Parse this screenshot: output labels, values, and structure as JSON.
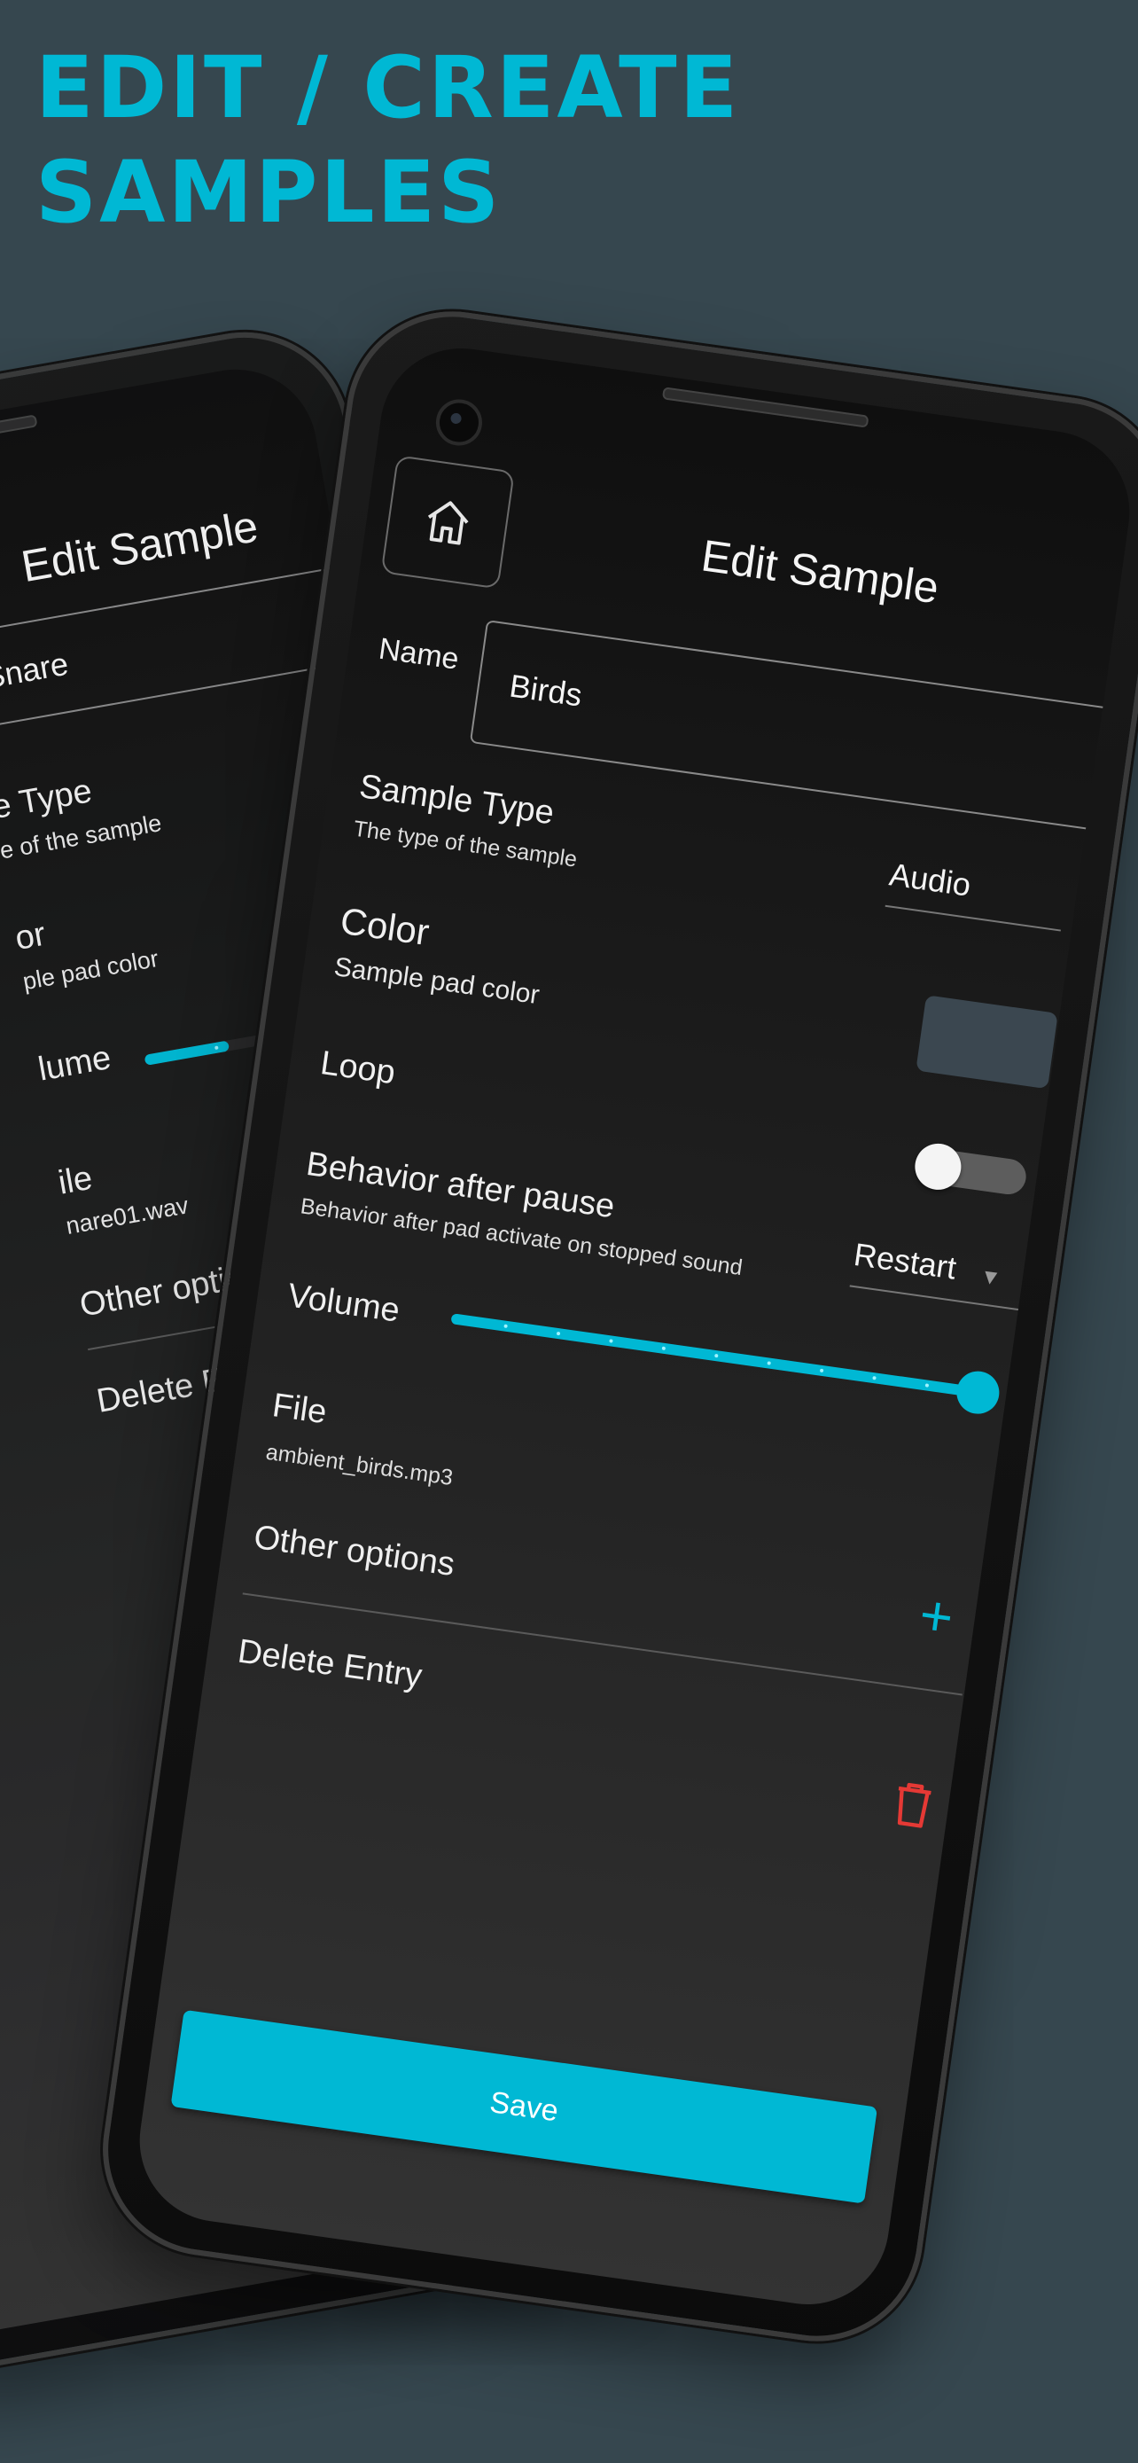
{
  "headline": {
    "line1": "EDIT / CREATE",
    "line2": "SAMPLES"
  },
  "front": {
    "title": "Edit Sample",
    "name_label": "Name",
    "name_value": "Birds",
    "sample_type": {
      "title": "Sample Type",
      "subtitle": "The type of the sample",
      "value": "Audio"
    },
    "color": {
      "title": "Color",
      "subtitle": "Sample pad color",
      "swatch": "#3b4750"
    },
    "loop": {
      "title": "Loop",
      "on": false
    },
    "behavior": {
      "title": "Behavior after pause",
      "subtitle": "Behavior after pad activate on stopped sound",
      "value": "Restart"
    },
    "volume": {
      "title": "Volume",
      "level": 1.0
    },
    "file": {
      "title": "File",
      "value": "ambient_birds.mp3"
    },
    "other_options": "Other options",
    "delete_entry": "Delete Entry",
    "save": "Save"
  },
  "back": {
    "title": "Edit Sample",
    "name_value": "Snare",
    "sample_type": {
      "title": "e Type",
      "subtitle": "e of the sample"
    },
    "color": {
      "title": "or",
      "subtitle": "ple pad color"
    },
    "volume_title": "lume",
    "volume_level": 0.3,
    "file": {
      "title": "ile",
      "value": "nare01.wav"
    },
    "other_options": "Other options",
    "delete_entry": "Delete Entry"
  },
  "colors": {
    "accent": "#00b8d4",
    "background": "#36474f",
    "danger": "#e53935"
  },
  "icons": {
    "home": "home-icon",
    "plus": "plus-icon",
    "trash": "trash-icon",
    "dropdown": "caret-down-icon"
  }
}
